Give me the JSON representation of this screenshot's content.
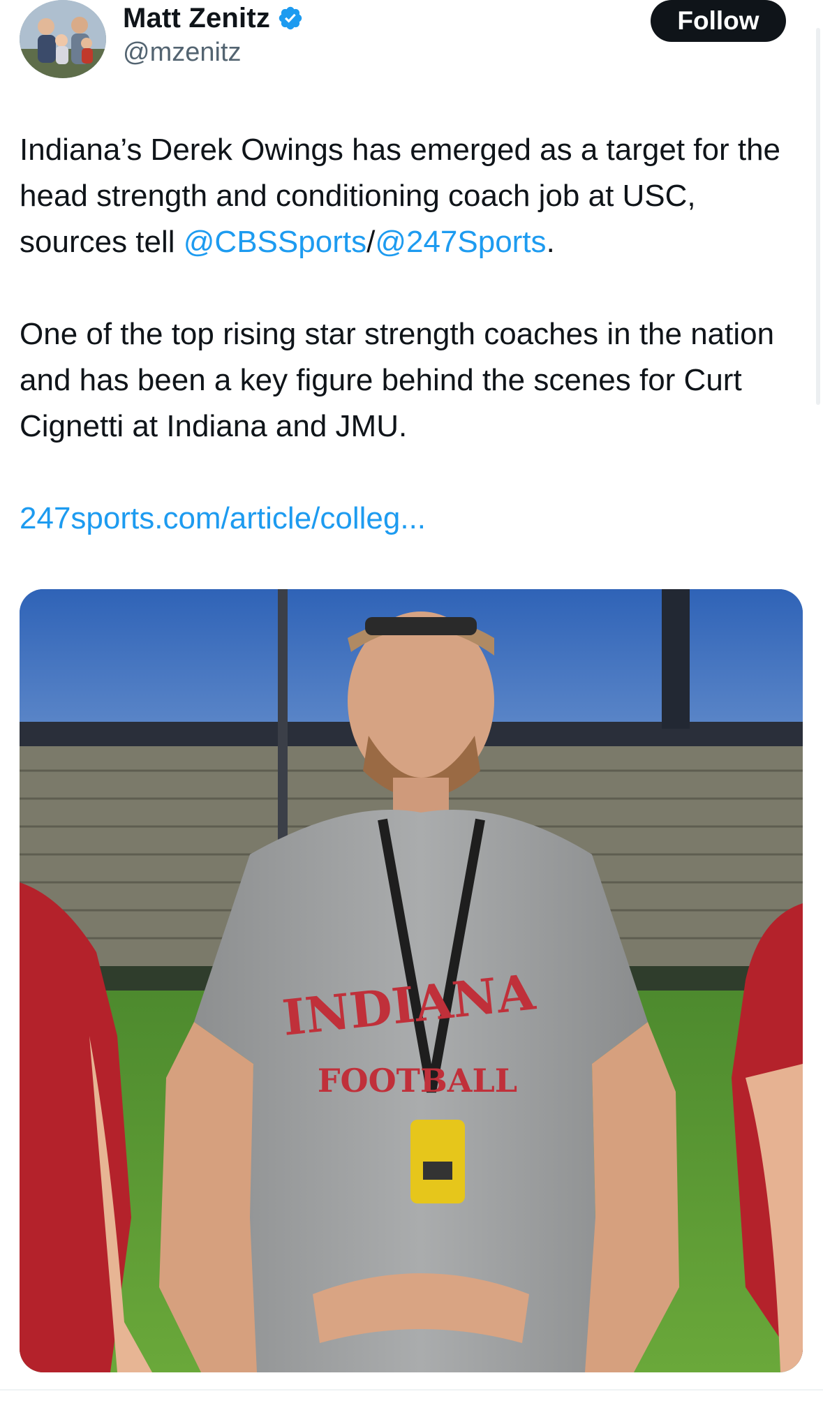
{
  "author": {
    "display_name": "Matt Zenitz",
    "handle": "@mzenitz",
    "verified": true,
    "verified_color": "#1d9bf0"
  },
  "actions": {
    "follow_label": "Follow"
  },
  "tweet": {
    "paragraph1": {
      "text_before": "Indiana’s Derek Owings has emerged as a target for the head strength and conditioning coach job at USC, sources tell ",
      "mention1": "@CBSSports",
      "separator": "/",
      "mention2": "@247Sports",
      "text_after": "."
    },
    "paragraph2": "One of the top rising star strength coaches in the nation and has been a key figure behind the scenes for Curt Cignetti at Indiana and JMU.",
    "link": "247sports.com/article/colleg..."
  },
  "media": {
    "shirt_text_top": "INDIANA",
    "shirt_text_bottom": "FOOTBALL"
  },
  "colors": {
    "link": "#1d9bf0",
    "text": "#0f1419",
    "secondary": "#536471",
    "button_bg": "#0f1419"
  }
}
